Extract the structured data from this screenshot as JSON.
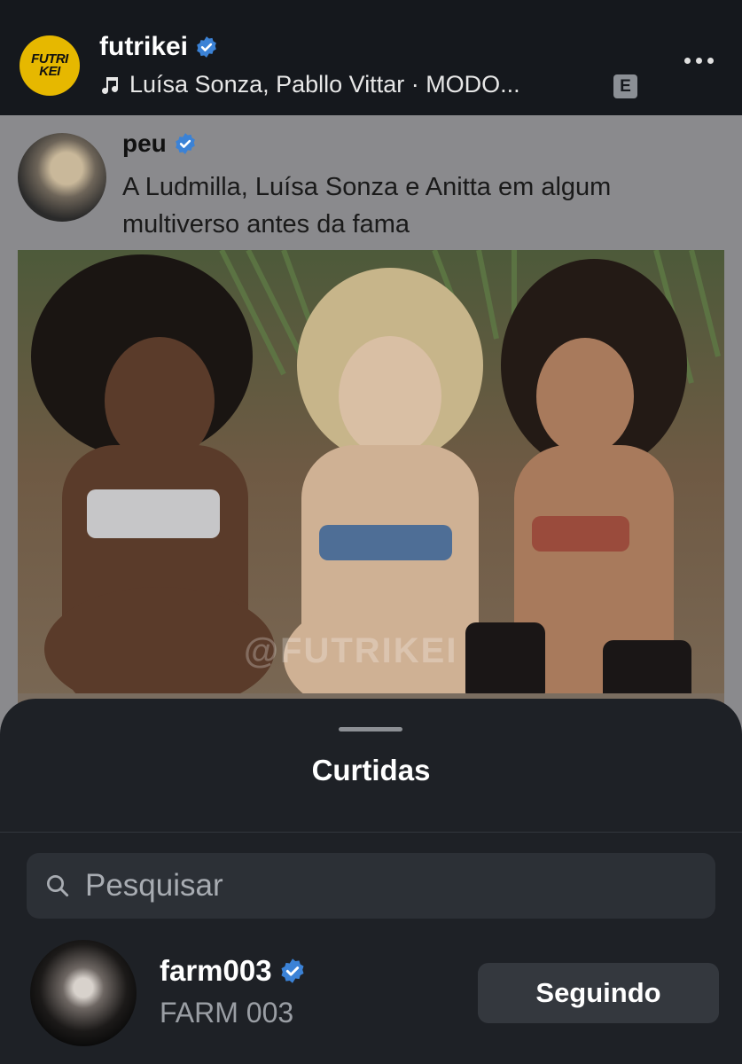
{
  "header": {
    "logo_text_line1": "FUTRI",
    "logo_text_line2": "KEI",
    "username": "futrikei",
    "music": "Luísa Sonza, Pabllo Vittar · MODO...",
    "explicit_badge": "E"
  },
  "tweet": {
    "username": "peu",
    "text": "A Ludmilla, Luísa Sonza e Anitta em algum multiverso antes da fama",
    "watermark": "@FUTRIKEI"
  },
  "sheet": {
    "title": "Curtidas",
    "search_placeholder": "Pesquisar",
    "users": [
      {
        "username": "farm003",
        "display_name": "FARM 003",
        "button_label": "Seguindo"
      }
    ]
  },
  "colors": {
    "verified": "#3b82d6",
    "logo": "#e6b800",
    "sheet_bg": "#1e2126"
  }
}
